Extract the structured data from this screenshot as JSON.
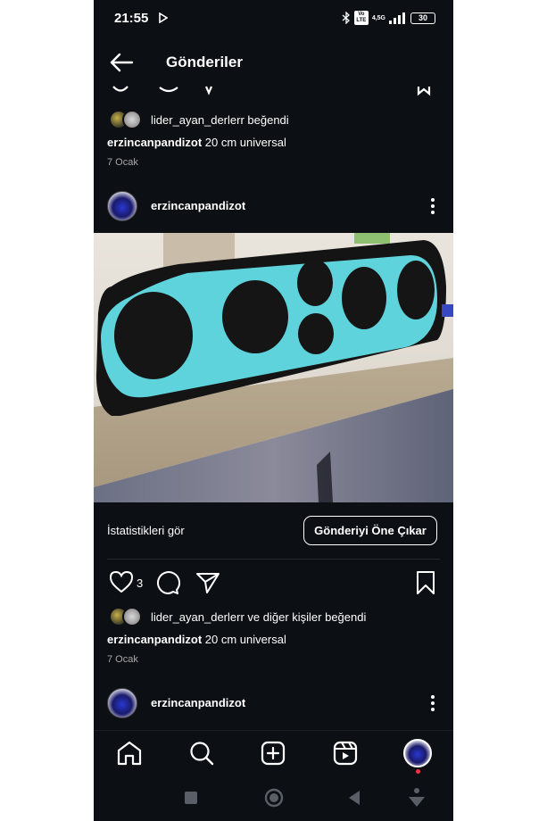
{
  "status_bar": {
    "time": "21:55",
    "network": "4,5G",
    "volte": "Vo LTE",
    "battery": "30"
  },
  "header": {
    "title": "Gönderiler"
  },
  "prev_post": {
    "liked_by_user": "lider_ayan_derlerr",
    "liked_suffix": " beğendi",
    "caption_user": "erzincanpandizot",
    "caption_text": " 20 cm universal",
    "date": "7 Ocak"
  },
  "post": {
    "username": "erzincanpandizot",
    "insights_label": "İstatistikleri gör",
    "boost_label": "Gönderiyi Öne Çıkar",
    "like_count": "3",
    "liked_by_user": "lider_ayan_derlerr",
    "liked_suffix": " ve diğer kişiler beğendi",
    "caption_user": "erzincanpandizot",
    "caption_text": " 20 cm universal",
    "date": "7 Ocak"
  },
  "next_post": {
    "username": "erzincanpandizot"
  },
  "bottom_nav": {
    "items": [
      "home-icon",
      "search-icon",
      "create-icon",
      "reels-icon",
      "profile-avatar"
    ]
  },
  "system_nav": {
    "items": [
      "recents-button",
      "home-button",
      "back-button",
      "accessibility-button"
    ]
  },
  "colors": {
    "background": "#0c0f14",
    "text": "#ffffff",
    "secondary_text": "#a8a8a8",
    "panel_cyan": "#5fd3dc",
    "notification_red": "#ff3040"
  }
}
